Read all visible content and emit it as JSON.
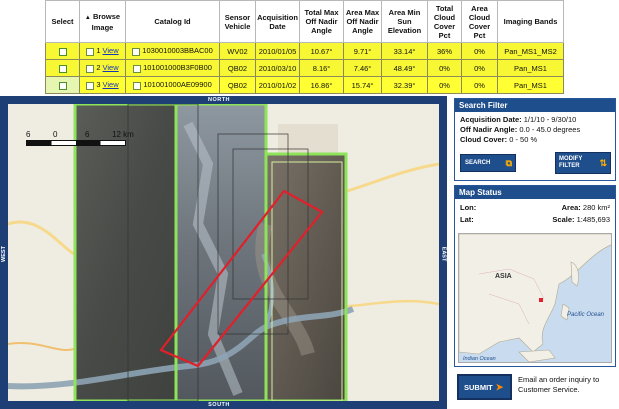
{
  "results_table": {
    "headers": {
      "select": "Select",
      "browse": "Browse Image",
      "sort_arrow": "▲",
      "catalog": "Catalog Id",
      "sensor": "Sensor Vehicle",
      "acq": "Acquisition Date",
      "total_off_nadir": "Total Max Off Nadir Angle",
      "area_off_nadir": "Area Max Off Nadir Angle",
      "sun_elev": "Area Min Sun Elevation",
      "total_cloud": "Total Cloud Cover Pct",
      "area_cloud": "Area Cloud Cover Pct",
      "bands": "Imaging Bands"
    },
    "view_label": "View",
    "rows": [
      {
        "num": "1",
        "catalog_id": "1030010003BBAC00",
        "sensor": "WV02",
        "date": "2010/01/05",
        "total_off_nadir": "10.67°",
        "area_off_nadir": "9.71°",
        "sun_elev": "33.14°",
        "total_cloud": "36%",
        "area_cloud": "0%",
        "bands": "Pan_MS1_MS2"
      },
      {
        "num": "2",
        "catalog_id": "101001000B3F0B00",
        "sensor": "QB02",
        "date": "2010/03/10",
        "total_off_nadir": "8.16°",
        "area_off_nadir": "7.46°",
        "sun_elev": "48.49°",
        "total_cloud": "0%",
        "area_cloud": "0%",
        "bands": "Pan_MS1"
      },
      {
        "num": "3",
        "catalog_id": "101001000AE09900",
        "sensor": "QB02",
        "date": "2010/01/02",
        "total_off_nadir": "16.86°",
        "area_off_nadir": "15.74°",
        "sun_elev": "32.39°",
        "total_cloud": "0%",
        "area_cloud": "0%",
        "bands": "Pan_MS1"
      }
    ]
  },
  "map": {
    "nav": {
      "north": "NORTH",
      "south": "SOUTH",
      "west": "WEST",
      "east": "EAST"
    },
    "scale_labels": [
      "6",
      "0",
      "6",
      "12 km"
    ]
  },
  "search_filter": {
    "title": "Search Filter",
    "acq_label": "Acquisition Date:",
    "acq_value": "1/1/10 - 9/30/10",
    "nadir_label": "Off Nadir Angle:",
    "nadir_value": "0.0 - 45.0 degrees",
    "cloud_label": "Cloud Cover:",
    "cloud_value": "0 - 50 %",
    "search_btn": "SEARCH",
    "modify_btn_line1": "MODIFY",
    "modify_btn_line2": "FILTER"
  },
  "map_status": {
    "title": "Map Status",
    "lon_label": "Lon:",
    "lat_label": "Lat:",
    "area_label": "Area:",
    "area_value": "280 km²",
    "scale_label": "Scale:",
    "scale_value": "1:485,693",
    "overview_labels": {
      "asia": "ASIA",
      "pacific": "Pacific Ocean",
      "indian": "Indian Ocean"
    }
  },
  "submit": {
    "button": "SUBMIT",
    "text": "Email an order inquiry to Customer Service."
  },
  "colors": {
    "header_blue": "#1f4e8c",
    "row_yellow": "#ffff33",
    "strip_green": "#8fe35a",
    "aoi_red": "#e0202a"
  }
}
